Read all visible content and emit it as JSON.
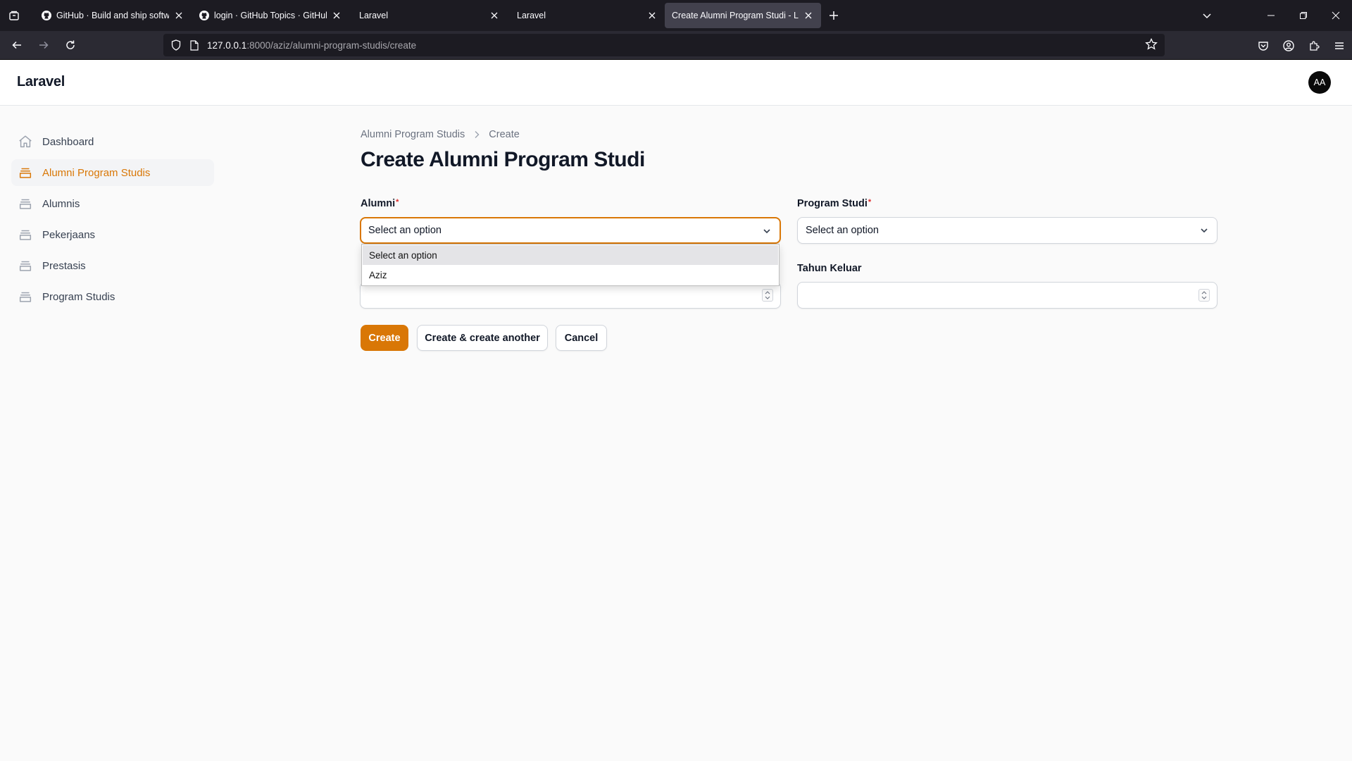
{
  "browser": {
    "tabs": [
      {
        "title": "GitHub · Build and ship software",
        "icon": "github-icon"
      },
      {
        "title": "login · GitHub Topics · GitHub",
        "icon": "github-icon"
      },
      {
        "title": "Laravel",
        "icon": ""
      },
      {
        "title": "Laravel",
        "icon": ""
      },
      {
        "title": "Create Alumni Program Studi - Laravel",
        "icon": ""
      }
    ],
    "url_host": "127.0.0.1",
    "url_path": ":8000/aziz/alumni-program-studis/create"
  },
  "app": {
    "brand": "Laravel",
    "avatar_initials": "AA",
    "accent_color": "#d97706"
  },
  "sidebar": {
    "items": [
      {
        "label": "Dashboard",
        "icon": "home-icon"
      },
      {
        "label": "Alumni Program Studis",
        "icon": "collection-icon"
      },
      {
        "label": "Alumnis",
        "icon": "collection-icon"
      },
      {
        "label": "Pekerjaans",
        "icon": "collection-icon"
      },
      {
        "label": "Prestasis",
        "icon": "collection-icon"
      },
      {
        "label": "Program Studis",
        "icon": "collection-icon"
      }
    ]
  },
  "breadcrumb": {
    "parent": "Alumni Program Studis",
    "current": "Create"
  },
  "page": {
    "title": "Create Alumni Program Studi"
  },
  "form": {
    "alumni": {
      "label": "Alumni",
      "required": "*",
      "value": "Select an option"
    },
    "program_studi": {
      "label": "Program Studi",
      "required": "*",
      "value": "Select an option"
    },
    "tahun_keluar": {
      "label": "Tahun Keluar",
      "value": ""
    },
    "tahun_masuk": {
      "value": ""
    }
  },
  "dropdown": {
    "options": [
      "Select an option",
      "Aziz"
    ],
    "highlighted": "Select an option"
  },
  "actions": {
    "create": "Create",
    "create_another": "Create & create another",
    "cancel": "Cancel"
  }
}
